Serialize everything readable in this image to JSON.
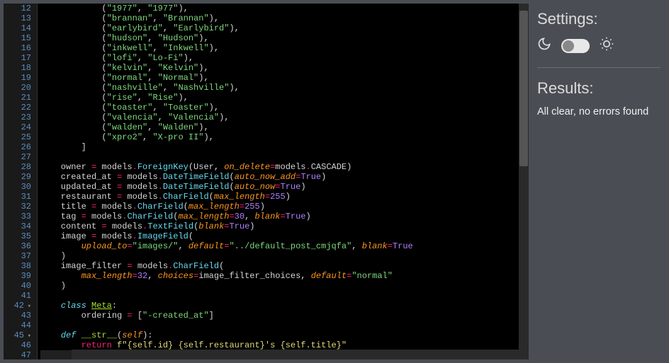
{
  "editor": {
    "first_line_number": 12,
    "fold_markers": [
      42,
      45
    ],
    "cursor_line": 47,
    "lines": [
      {
        "n": 12,
        "t": "            (\"1977\", \"1977\"),",
        "tok": [
          [
            "p",
            "            ("
          ],
          [
            "s",
            "\"1977\""
          ],
          [
            "p",
            ", "
          ],
          [
            "s",
            "\"1977\""
          ],
          [
            "p",
            "),"
          ]
        ]
      },
      {
        "n": 13,
        "t": "            (\"brannan\", \"Brannan\"),",
        "tok": [
          [
            "p",
            "            ("
          ],
          [
            "s",
            "\"brannan\""
          ],
          [
            "p",
            ", "
          ],
          [
            "s",
            "\"Brannan\""
          ],
          [
            "p",
            "),"
          ]
        ]
      },
      {
        "n": 14,
        "t": "            (\"earlybird\", \"Earlybird\"),",
        "tok": [
          [
            "p",
            "            ("
          ],
          [
            "s",
            "\"earlybird\""
          ],
          [
            "p",
            ", "
          ],
          [
            "s",
            "\"Earlybird\""
          ],
          [
            "p",
            "),"
          ]
        ]
      },
      {
        "n": 15,
        "t": "            (\"hudson\", \"Hudson\"),",
        "tok": [
          [
            "p",
            "            ("
          ],
          [
            "s",
            "\"hudson\""
          ],
          [
            "p",
            ", "
          ],
          [
            "s",
            "\"Hudson\""
          ],
          [
            "p",
            "),"
          ]
        ]
      },
      {
        "n": 16,
        "t": "            (\"inkwell\", \"Inkwell\"),",
        "tok": [
          [
            "p",
            "            ("
          ],
          [
            "s",
            "\"inkwell\""
          ],
          [
            "p",
            ", "
          ],
          [
            "s",
            "\"Inkwell\""
          ],
          [
            "p",
            "),"
          ]
        ]
      },
      {
        "n": 17,
        "t": "            (\"lofi\", \"Lo-Fi\"),",
        "tok": [
          [
            "p",
            "            ("
          ],
          [
            "s",
            "\"lofi\""
          ],
          [
            "p",
            ", "
          ],
          [
            "s",
            "\"Lo-Fi\""
          ],
          [
            "p",
            "),"
          ]
        ]
      },
      {
        "n": 18,
        "t": "            (\"kelvin\", \"Kelvin\"),",
        "tok": [
          [
            "p",
            "            ("
          ],
          [
            "s",
            "\"kelvin\""
          ],
          [
            "p",
            ", "
          ],
          [
            "s",
            "\"Kelvin\""
          ],
          [
            "p",
            "),"
          ]
        ]
      },
      {
        "n": 19,
        "t": "            (\"normal\", \"Normal\"),",
        "tok": [
          [
            "p",
            "            ("
          ],
          [
            "s",
            "\"normal\""
          ],
          [
            "p",
            ", "
          ],
          [
            "s",
            "\"Normal\""
          ],
          [
            "p",
            "),"
          ]
        ]
      },
      {
        "n": 20,
        "t": "            (\"nashville\", \"Nashville\"),",
        "tok": [
          [
            "p",
            "            ("
          ],
          [
            "s",
            "\"nashville\""
          ],
          [
            "p",
            ", "
          ],
          [
            "s",
            "\"Nashville\""
          ],
          [
            "p",
            "),"
          ]
        ]
      },
      {
        "n": 21,
        "t": "            (\"rise\", \"Rise\"),",
        "tok": [
          [
            "p",
            "            ("
          ],
          [
            "s",
            "\"rise\""
          ],
          [
            "p",
            ", "
          ],
          [
            "s",
            "\"Rise\""
          ],
          [
            "p",
            "),"
          ]
        ]
      },
      {
        "n": 22,
        "t": "            (\"toaster\", \"Toaster\"),",
        "tok": [
          [
            "p",
            "            ("
          ],
          [
            "s",
            "\"toaster\""
          ],
          [
            "p",
            ", "
          ],
          [
            "s",
            "\"Toaster\""
          ],
          [
            "p",
            "),"
          ]
        ]
      },
      {
        "n": 23,
        "t": "            (\"valencia\", \"Valencia\"),",
        "tok": [
          [
            "p",
            "            ("
          ],
          [
            "s",
            "\"valencia\""
          ],
          [
            "p",
            ", "
          ],
          [
            "s",
            "\"Valencia\""
          ],
          [
            "p",
            "),"
          ]
        ]
      },
      {
        "n": 24,
        "t": "            (\"walden\", \"Walden\"),",
        "tok": [
          [
            "p",
            "            ("
          ],
          [
            "s",
            "\"walden\""
          ],
          [
            "p",
            ", "
          ],
          [
            "s",
            "\"Walden\""
          ],
          [
            "p",
            "),"
          ]
        ]
      },
      {
        "n": 25,
        "t": "            (\"xpro2\", \"X-pro II\"),",
        "tok": [
          [
            "p",
            "            ("
          ],
          [
            "s",
            "\"xpro2\""
          ],
          [
            "p",
            ", "
          ],
          [
            "s",
            "\"X-pro II\""
          ],
          [
            "p",
            "),"
          ]
        ]
      },
      {
        "n": 26,
        "t": "        ]",
        "tok": [
          [
            "p",
            "        ]"
          ]
        ]
      },
      {
        "n": 27,
        "t": "",
        "tok": [
          [
            "p",
            ""
          ]
        ]
      },
      {
        "n": 28,
        "t": "    owner = models.ForeignKey(User, on_delete=models.CASCADE)",
        "tok": [
          [
            "v",
            "    owner "
          ],
          [
            "o",
            "="
          ],
          [
            "v",
            " models"
          ],
          [
            "d",
            "."
          ],
          [
            "f",
            "ForeignKey"
          ],
          [
            "p",
            "(User, "
          ],
          [
            "a",
            "on_delete"
          ],
          [
            "o",
            "="
          ],
          [
            "v",
            "models"
          ],
          [
            "d",
            "."
          ],
          [
            "v",
            "CASCADE"
          ],
          [
            "p",
            ")"
          ]
        ]
      },
      {
        "n": 29,
        "t": "    created_at = models.DateTimeField(auto_now_add=True)",
        "tok": [
          [
            "v",
            "    created_at "
          ],
          [
            "o",
            "="
          ],
          [
            "v",
            " models"
          ],
          [
            "d",
            "."
          ],
          [
            "f",
            "DateTimeField"
          ],
          [
            "p",
            "("
          ],
          [
            "a",
            "auto_now_add"
          ],
          [
            "o",
            "="
          ],
          [
            "c",
            "True"
          ],
          [
            "p",
            ")"
          ]
        ]
      },
      {
        "n": 30,
        "t": "    updated_at = models.DateTimeField(auto_now=True)",
        "tok": [
          [
            "v",
            "    updated_at "
          ],
          [
            "o",
            "="
          ],
          [
            "v",
            " models"
          ],
          [
            "d",
            "."
          ],
          [
            "f",
            "DateTimeField"
          ],
          [
            "p",
            "("
          ],
          [
            "a",
            "auto_now"
          ],
          [
            "o",
            "="
          ],
          [
            "c",
            "True"
          ],
          [
            "p",
            ")"
          ]
        ]
      },
      {
        "n": 31,
        "t": "    restaurant = models.CharField(max_length=255)",
        "tok": [
          [
            "v",
            "    restaurant "
          ],
          [
            "o",
            "="
          ],
          [
            "v",
            " models"
          ],
          [
            "d",
            "."
          ],
          [
            "f",
            "CharField"
          ],
          [
            "p",
            "("
          ],
          [
            "a",
            "max_length"
          ],
          [
            "o",
            "="
          ],
          [
            "n",
            "255"
          ],
          [
            "p",
            ")"
          ]
        ]
      },
      {
        "n": 32,
        "t": "    title = models.CharField(max_length=255)",
        "tok": [
          [
            "v",
            "    title "
          ],
          [
            "o",
            "="
          ],
          [
            "v",
            " models"
          ],
          [
            "d",
            "."
          ],
          [
            "f",
            "CharField"
          ],
          [
            "p",
            "("
          ],
          [
            "a",
            "max_length"
          ],
          [
            "o",
            "="
          ],
          [
            "n",
            "255"
          ],
          [
            "p",
            ")"
          ]
        ]
      },
      {
        "n": 33,
        "t": "    tag = models.CharField(max_length=30, blank=True)",
        "tok": [
          [
            "v",
            "    tag "
          ],
          [
            "o",
            "="
          ],
          [
            "v",
            " models"
          ],
          [
            "d",
            "."
          ],
          [
            "f",
            "CharField"
          ],
          [
            "p",
            "("
          ],
          [
            "a",
            "max_length"
          ],
          [
            "o",
            "="
          ],
          [
            "n",
            "30"
          ],
          [
            "p",
            ", "
          ],
          [
            "a",
            "blank"
          ],
          [
            "o",
            "="
          ],
          [
            "c",
            "True"
          ],
          [
            "p",
            ")"
          ]
        ]
      },
      {
        "n": 34,
        "t": "    content = models.TextField(blank=True)",
        "tok": [
          [
            "v",
            "    content "
          ],
          [
            "o",
            "="
          ],
          [
            "v",
            " models"
          ],
          [
            "d",
            "."
          ],
          [
            "f",
            "TextField"
          ],
          [
            "p",
            "("
          ],
          [
            "a",
            "blank"
          ],
          [
            "o",
            "="
          ],
          [
            "c",
            "True"
          ],
          [
            "p",
            ")"
          ]
        ]
      },
      {
        "n": 35,
        "t": "    image = models.ImageField(",
        "tok": [
          [
            "v",
            "    image "
          ],
          [
            "o",
            "="
          ],
          [
            "v",
            " models"
          ],
          [
            "d",
            "."
          ],
          [
            "f",
            "ImageField"
          ],
          [
            "p",
            "("
          ]
        ]
      },
      {
        "n": 36,
        "t": "        upload_to=\"images/\", default=\"../default_post_cmjqfa\", blank=True",
        "tok": [
          [
            "p",
            "        "
          ],
          [
            "a",
            "upload_to"
          ],
          [
            "o",
            "="
          ],
          [
            "s",
            "\"images/\""
          ],
          [
            "p",
            ", "
          ],
          [
            "a",
            "default"
          ],
          [
            "o",
            "="
          ],
          [
            "s",
            "\"../default_post_cmjqfa\""
          ],
          [
            "p",
            ", "
          ],
          [
            "a",
            "blank"
          ],
          [
            "o",
            "="
          ],
          [
            "c",
            "True"
          ]
        ]
      },
      {
        "n": 37,
        "t": "    )",
        "tok": [
          [
            "p",
            "    )"
          ]
        ]
      },
      {
        "n": 38,
        "t": "    image_filter = models.CharField(",
        "tok": [
          [
            "v",
            "    image_filter "
          ],
          [
            "o",
            "="
          ],
          [
            "v",
            " models"
          ],
          [
            "d",
            "."
          ],
          [
            "f",
            "CharField"
          ],
          [
            "p",
            "("
          ]
        ]
      },
      {
        "n": 39,
        "t": "        max_length=32, choices=image_filter_choices, default=\"normal\"",
        "tok": [
          [
            "p",
            "        "
          ],
          [
            "a",
            "max_length"
          ],
          [
            "o",
            "="
          ],
          [
            "n",
            "32"
          ],
          [
            "p",
            ", "
          ],
          [
            "a",
            "choices"
          ],
          [
            "o",
            "="
          ],
          [
            "v",
            "image_filter_choices"
          ],
          [
            "p",
            ", "
          ],
          [
            "a",
            "default"
          ],
          [
            "o",
            "="
          ],
          [
            "s",
            "\"normal\""
          ]
        ]
      },
      {
        "n": 40,
        "t": "    )",
        "tok": [
          [
            "p",
            "    )"
          ]
        ]
      },
      {
        "n": 41,
        "t": "",
        "tok": [
          [
            "p",
            ""
          ]
        ]
      },
      {
        "n": 42,
        "t": "    class Meta:",
        "tok": [
          [
            "p",
            "    "
          ],
          [
            "df",
            "class"
          ],
          [
            "p",
            " "
          ],
          [
            "cl",
            "Meta"
          ],
          [
            "p",
            ":"
          ]
        ]
      },
      {
        "n": 43,
        "t": "        ordering = [\"-created_at\"]",
        "tok": [
          [
            "v",
            "        ordering "
          ],
          [
            "o",
            "="
          ],
          [
            "p",
            " ["
          ],
          [
            "s",
            "\"-created_at\""
          ],
          [
            "p",
            "]"
          ]
        ]
      },
      {
        "n": 44,
        "t": "",
        "tok": [
          [
            "p",
            ""
          ]
        ]
      },
      {
        "n": 45,
        "t": "    def __str__(self):",
        "tok": [
          [
            "p",
            "    "
          ],
          [
            "df",
            "def"
          ],
          [
            "p",
            " "
          ],
          [
            "fn",
            "__str__"
          ],
          [
            "p",
            "("
          ],
          [
            "sf",
            "self"
          ],
          [
            "p",
            "):"
          ]
        ]
      },
      {
        "n": 46,
        "t": "        return f\"{self.id} {self.restaurant}'s {self.title}\"",
        "tok": [
          [
            "p",
            "        "
          ],
          [
            "k",
            "return"
          ],
          [
            "p",
            " "
          ],
          [
            "fs",
            "f\"{self.id} {self.restaurant}'s {self.title}\""
          ]
        ]
      },
      {
        "n": 47,
        "t": "",
        "tok": [
          [
            "p",
            ""
          ]
        ]
      }
    ]
  },
  "sidebar": {
    "settings_title": "Settings:",
    "results_title": "Results:",
    "results_text": "All clear, no errors found",
    "theme_toggle_state": "dark"
  }
}
